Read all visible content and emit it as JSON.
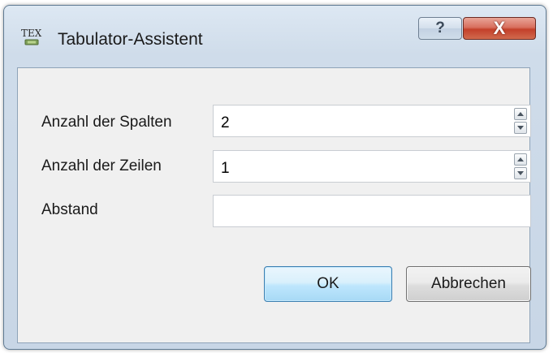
{
  "window": {
    "title": "Tabulator-Assistent",
    "icon": "tex-icon",
    "icon_text": "TEX",
    "help_glyph": "?",
    "close_glyph": "X"
  },
  "form": {
    "columns": {
      "label": "Anzahl der Spalten",
      "value": "2"
    },
    "rows": {
      "label": "Anzahl der Zeilen",
      "value": "1"
    },
    "spacing": {
      "label": "Abstand",
      "value": ""
    }
  },
  "buttons": {
    "ok": "OK",
    "cancel": "Abbrechen"
  },
  "colors": {
    "close_button": "#c4402a",
    "default_button_border": "#3c7fb1",
    "client_background": "#f0f0f0"
  }
}
